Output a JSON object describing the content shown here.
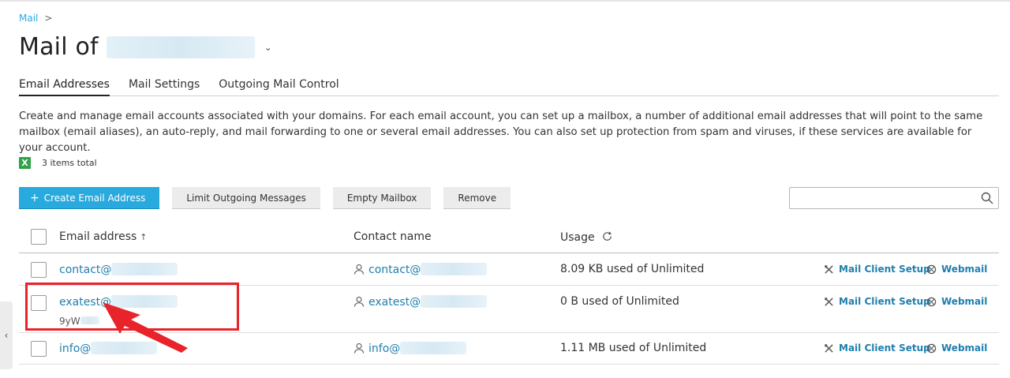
{
  "breadcrumb": {
    "root": "Mail",
    "separator": ">"
  },
  "header": {
    "title": "Mail of"
  },
  "tabs": [
    {
      "label": "Email Addresses",
      "active": true
    },
    {
      "label": "Mail Settings",
      "active": false
    },
    {
      "label": "Outgoing Mail Control",
      "active": false
    }
  ],
  "description": "Create and manage email accounts associated with your domains. For each email account, you can set up a mailbox, a number of additional email addresses that will point to the same mailbox (email aliases), an auto-reply, and mail forwarding to one or several email addresses. You can also set up protection from spam and viruses, if these services are available for your account.",
  "summary": {
    "total_label": "3 items total",
    "export_icon": "excel-export-icon"
  },
  "toolbar": {
    "create_label": "Create Email Address",
    "limit_label": "Limit Outgoing Messages",
    "empty_label": "Empty Mailbox",
    "remove_label": "Remove"
  },
  "search": {
    "placeholder": ""
  },
  "table": {
    "columns": {
      "email": "Email address",
      "contact": "Contact name",
      "usage": "Usage"
    },
    "rows": [
      {
        "email": "contact@",
        "contact": "contact@",
        "usage": "8.09 KB used of Unlimited",
        "sub": "",
        "mail_client": "Mail Client Setup",
        "webmail": "Webmail"
      },
      {
        "email": "exatest@",
        "contact": "exatest@",
        "usage": "0 B used of Unlimited",
        "sub": "9yW",
        "mail_client": "Mail Client Setup",
        "webmail": "Webmail"
      },
      {
        "email": "info@",
        "contact": "info@",
        "usage": "1.11 MB used of Unlimited",
        "sub": "",
        "mail_client": "Mail Client Setup",
        "webmail": "Webmail"
      }
    ]
  },
  "colors": {
    "accent": "#28aade",
    "link": "#1f7fae",
    "annotation": "#e8232a",
    "excel": "#33a04a"
  }
}
